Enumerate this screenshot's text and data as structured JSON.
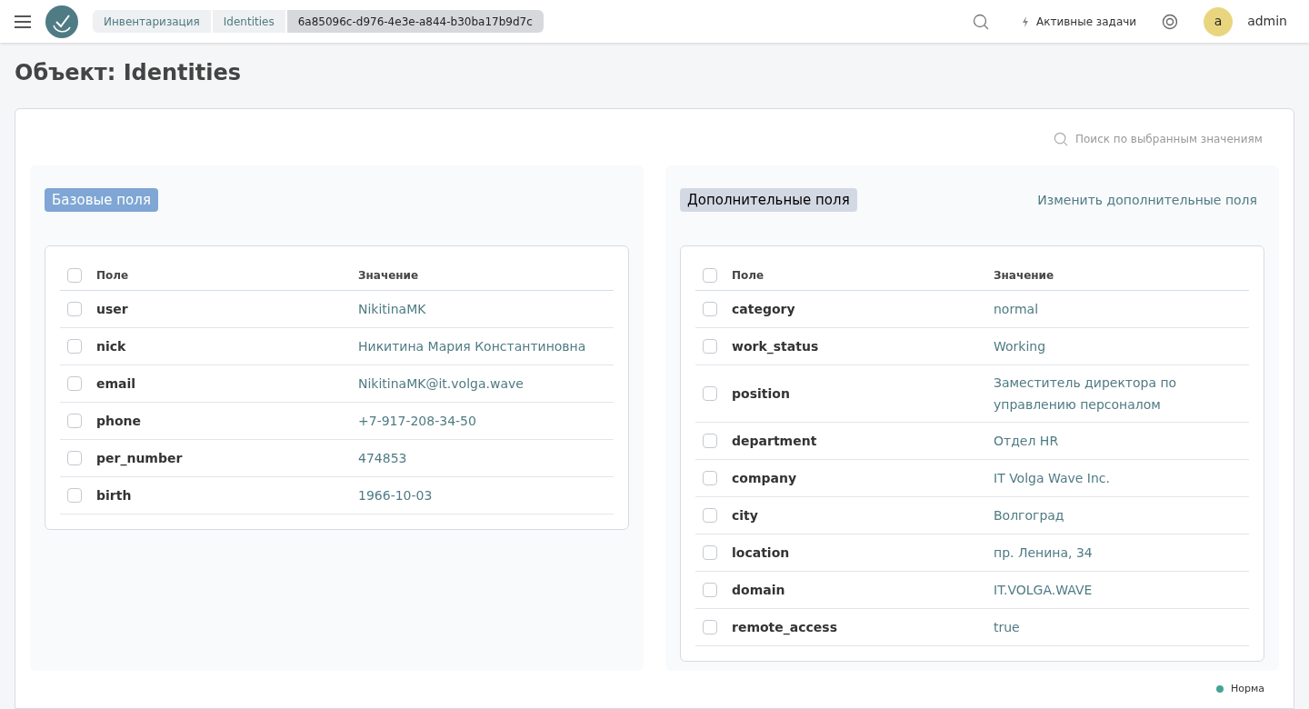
{
  "breadcrumbs": [
    {
      "label": "Инвентаризация",
      "selected": false
    },
    {
      "label": "Identities",
      "selected": false
    },
    {
      "label": "6a85096c-d976-4e3e-a844-b30ba17b9d7c",
      "selected": true
    }
  ],
  "header": {
    "tasks": "Активные задачи",
    "avatar": "a",
    "user": "admin"
  },
  "title": "Объект: Identities",
  "search": {
    "placeholder": "Поиск по выбранным значениям"
  },
  "panels": [
    {
      "tag": "Базовые поля",
      "kind": "base",
      "columns": [
        "Поле",
        "Значение"
      ],
      "all_checked": false,
      "rows": [
        {
          "field": "user",
          "value": "NikitinaMK",
          "checked": false
        },
        {
          "field": "nick",
          "value": "Никитина Мария Константиновна",
          "checked": false
        },
        {
          "field": "email",
          "value": "NikitinaMK@it.volga.wave",
          "checked": false
        },
        {
          "field": "phone",
          "value": "+7-917-208-34-50",
          "checked": false
        },
        {
          "field": "per_number",
          "value": "474853",
          "checked": false
        },
        {
          "field": "birth",
          "value": "1966-10-03",
          "checked": false
        }
      ]
    },
    {
      "tag": "Дополнительные поля",
      "kind": "extra",
      "link": "Изменить дополнительные поля",
      "columns": [
        "Поле",
        "Значение"
      ],
      "all_checked": false,
      "rows": [
        {
          "field": "category",
          "value": "normal",
          "checked": false
        },
        {
          "field": "work_status",
          "value": "Working",
          "checked": false
        },
        {
          "field": "position",
          "value": "Заместитель директора по управлению персоналом",
          "checked": false
        },
        {
          "field": "department",
          "value": "Отдел HR",
          "checked": false
        },
        {
          "field": "company",
          "value": "IT Volga Wave Inc.",
          "checked": false
        },
        {
          "field": "city",
          "value": "Волгоград",
          "checked": false
        },
        {
          "field": "location",
          "value": "пр. Ленина, 34",
          "checked": false
        },
        {
          "field": "domain",
          "value": "IT.VOLGA.WAVE",
          "checked": false
        },
        {
          "field": "remote_access",
          "value": "true",
          "checked": false
        }
      ]
    }
  ],
  "status": "Норма"
}
